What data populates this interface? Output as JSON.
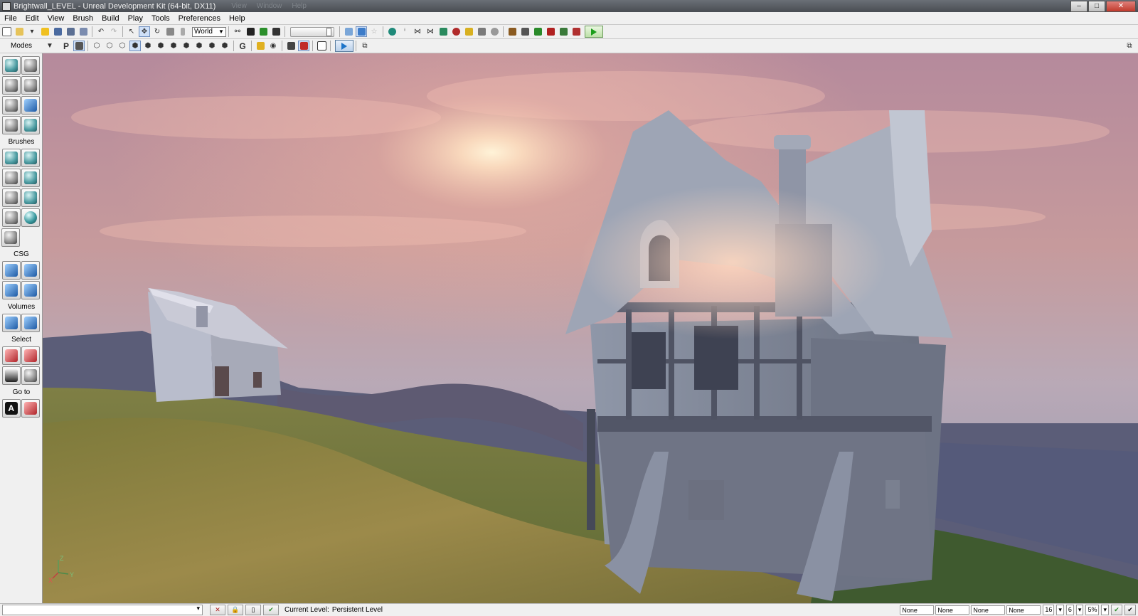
{
  "window": {
    "title": "Brightwall_LEVEL - Unreal Development Kit (64-bit, DX11)",
    "ghost_menu": [
      "View",
      "Window",
      "Help"
    ],
    "controls": [
      "–",
      "□",
      "✕"
    ]
  },
  "menu": [
    "File",
    "Edit",
    "View",
    "Brush",
    "Build",
    "Play",
    "Tools",
    "Preferences",
    "Help"
  ],
  "toolbar": {
    "coordinate_system": "World",
    "play_icon": "play-in-editor-icon"
  },
  "toolbar2": {
    "modes_label": "Modes",
    "p_label": "P",
    "g_label": "G"
  },
  "left_panel": {
    "sections": [
      "Brushes",
      "CSG",
      "Volumes",
      "Select",
      "Go to"
    ],
    "goto_a": "A"
  },
  "statusbar": {
    "current_level_label": "Current Level:",
    "current_level_value": "Persistent Level",
    "fields": [
      "None",
      "None",
      "None",
      "None"
    ],
    "grid": "16",
    "rotation": "6",
    "scale": "5%"
  },
  "viewport": {
    "axis_labels": [
      "Z",
      "X",
      "Y"
    ],
    "colors": {
      "sky_top": "#b58a9c",
      "sun": "#fff3d8",
      "grass": "#8a7d3f",
      "house": "#7f8898"
    }
  }
}
